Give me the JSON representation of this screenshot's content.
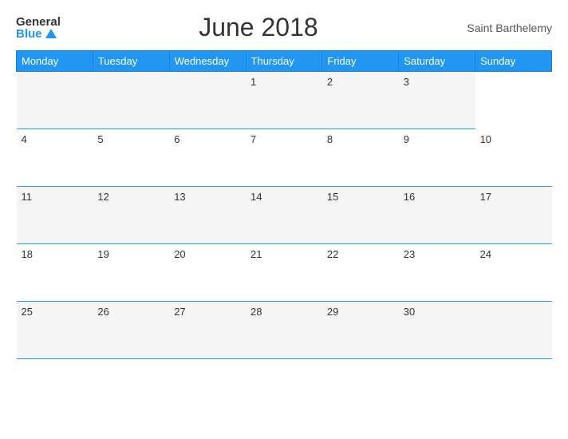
{
  "header": {
    "logo_general": "General",
    "logo_blue": "Blue",
    "title": "June 2018",
    "region": "Saint Barthelemy"
  },
  "calendar": {
    "weekdays": [
      "Monday",
      "Tuesday",
      "Wednesday",
      "Thursday",
      "Friday",
      "Saturday",
      "Sunday"
    ],
    "rows": [
      [
        "",
        "",
        "",
        "1",
        "2",
        "3"
      ],
      [
        "4",
        "5",
        "6",
        "7",
        "8",
        "9",
        "10"
      ],
      [
        "11",
        "12",
        "13",
        "14",
        "15",
        "16",
        "17"
      ],
      [
        "18",
        "19",
        "20",
        "21",
        "22",
        "23",
        "24"
      ],
      [
        "25",
        "26",
        "27",
        "28",
        "29",
        "30",
        ""
      ]
    ]
  }
}
